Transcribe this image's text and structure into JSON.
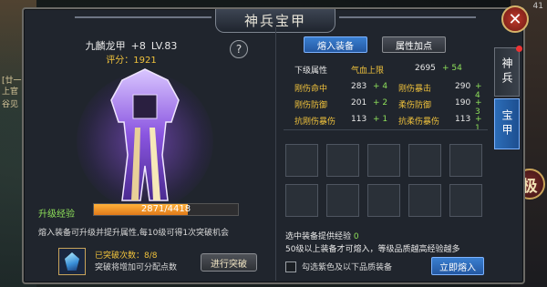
{
  "window": {
    "title": "神兵宝甲",
    "close_icon": "close-icon"
  },
  "background": {
    "left_texts": [
      "上官",
      "谷见",
      "[廿一]"
    ],
    "right_badge": "极",
    "right_number": "41"
  },
  "item": {
    "name": "九麟龙甲",
    "plus": "+8",
    "level": "LV.83",
    "score_label": "评分：",
    "score": "1921",
    "help_label": "?"
  },
  "experience": {
    "label": "升级经验",
    "current": 2871,
    "max": 4418,
    "text": "2871/4418"
  },
  "description": "熔入装备可升级并提升属性,每10级可得1次突破机会",
  "breakthrough": {
    "count_label": "已突破次数：8/8",
    "note": "突破将增加可分配点数",
    "button": "进行突破"
  },
  "tabs": {
    "fuse": "熔入装备",
    "attr_points": "属性加点"
  },
  "attributes": {
    "header": {
      "label": "下级属性",
      "name": "气血上限",
      "value": "2695",
      "bonus": "+ 54"
    },
    "rows": [
      [
        {
          "name": "刚伤命中",
          "value": "283",
          "bonus": "+ 4"
        },
        {
          "name": "刚伤暴击",
          "value": "290",
          "bonus": "+ 4"
        }
      ],
      [
        {
          "name": "刚伤防御",
          "value": "201",
          "bonus": "+ 2"
        },
        {
          "name": "柔伤防御",
          "value": "190",
          "bonus": "+ 3"
        }
      ],
      [
        {
          "name": "抗刚伤暴伤",
          "value": "113",
          "bonus": "+ 1"
        },
        {
          "name": "抗柔伤暴伤",
          "value": "113",
          "bonus": "+ 1"
        }
      ]
    ]
  },
  "fuse_panel": {
    "provide_label": "选中装备提供经验",
    "provide_value": "0",
    "rule": "50级以上装备才可熔入，等级品质越高经验越多",
    "checkbox_label": "勾选紫色及以下品质装备",
    "button": "立即熔入"
  },
  "side_tabs": [
    {
      "label": "神兵"
    },
    {
      "label": "宝甲"
    }
  ],
  "colors": {
    "accent_blue": "#2458a2",
    "gold": "#f0c23c",
    "green": "#8ee05a",
    "exp_orange": "#e07a1a"
  }
}
